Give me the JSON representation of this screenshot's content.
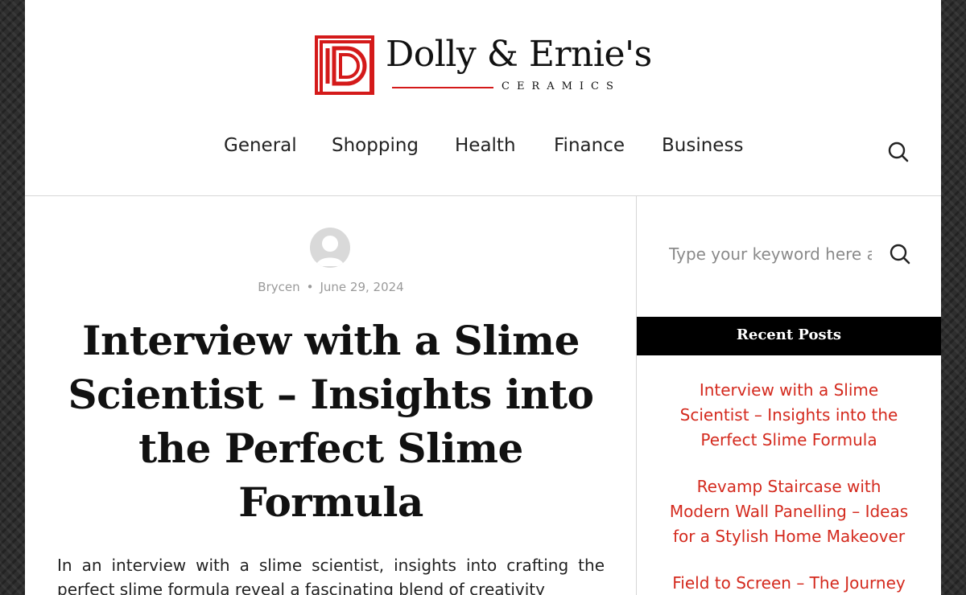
{
  "brand": {
    "name": "Dolly & Ernie's",
    "tagline": "CERAMICS",
    "accent_color": "#d41a1a"
  },
  "nav": {
    "items": [
      "General",
      "Shopping",
      "Health",
      "Finance",
      "Business"
    ],
    "search_icon": "search-icon"
  },
  "post": {
    "author": "Brycen",
    "separator": "•",
    "date": "June 29, 2024",
    "title": "Interview with a Slime Scientist – Insights into the Perfect Slime Formula",
    "excerpt": "In an interview with a slime scientist, insights into crafting the perfect slime formula reveal a fascinating blend of creativity"
  },
  "sidebar": {
    "search_placeholder": "Type your keyword here and hit enter",
    "recent_title": "Recent Posts",
    "recent_posts": [
      "Interview with a Slime Scientist – Insights into the Perfect Slime Formula",
      "Revamp Staircase with Modern Wall Panelling – Ideas for a Stylish Home Makeover",
      "Field to Screen – The Journey"
    ],
    "link_color": "#d42a1e"
  }
}
